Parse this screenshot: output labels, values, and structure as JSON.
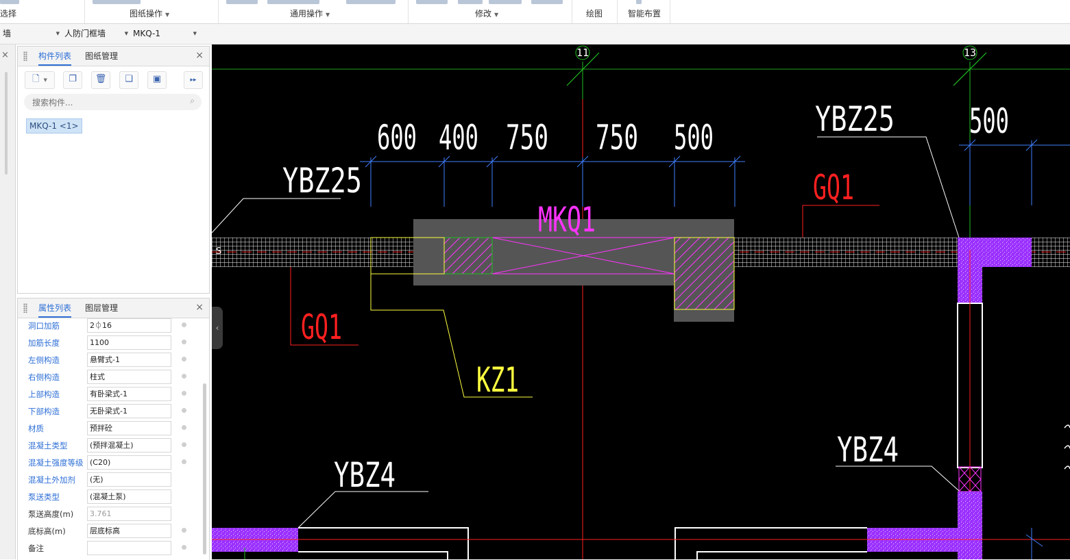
{
  "ribbon": {
    "groups": [
      {
        "label": "选择"
      },
      {
        "label": "图纸操作"
      },
      {
        "label": "通用操作"
      },
      {
        "label": "修改"
      },
      {
        "label": "绘图"
      },
      {
        "label": "智能布置"
      }
    ]
  },
  "toolbar": {
    "combo1": "墙",
    "combo2": "人防门框墙",
    "combo3": "MKQ-1"
  },
  "component_panel": {
    "tabs": [
      "构件列表",
      "图纸管理"
    ],
    "search_placeholder": "搜索构件...",
    "item": "MKQ-1 <1>"
  },
  "property_panel": {
    "tabs": [
      "属性列表",
      "图层管理"
    ],
    "rows": [
      {
        "name": "洞口加筋",
        "value": "2⏀16"
      },
      {
        "name": "加筋长度",
        "value": "1100"
      },
      {
        "name": "左侧构造",
        "value": "悬臂式-1"
      },
      {
        "name": "右侧构造",
        "value": "柱式"
      },
      {
        "name": "上部构造",
        "value": "有卧梁式-1"
      },
      {
        "name": "下部构造",
        "value": "无卧梁式-1"
      },
      {
        "name": "材质",
        "value": "预拌砼"
      },
      {
        "name": "混凝土类型",
        "value": "(预拌混凝土)"
      },
      {
        "name": "混凝土强度等级",
        "value": "(C20)"
      },
      {
        "name": "混凝土外加剂",
        "value": "(无)"
      },
      {
        "name": "泵送类型",
        "value": "(混凝土泵)"
      },
      {
        "name": "泵送高度(m)",
        "value": "3.761"
      },
      {
        "name": "底标高(m)",
        "value": "层底标高"
      },
      {
        "name": "备注",
        "value": ""
      }
    ]
  },
  "drawing": {
    "axis_11": "11",
    "axis_13": "13",
    "dims": [
      "600",
      "400",
      "750",
      "750",
      "500"
    ],
    "dim_right": "500",
    "ybz25_left": "YBZ25",
    "ybz25_right": "YBZ25",
    "gq1_right": "GQ1",
    "gq1_left": "GQ1",
    "mkq1": "MKQ1",
    "kz1": "KZ1",
    "ybz4_left": "YBZ4",
    "ybz4_right": "YBZ4",
    "s_mark": "S"
  },
  "colors": {
    "accent": "#2e6fd6",
    "cad_bg": "#000000",
    "magenta": "#ff33ff",
    "purple_fill": "#9b30ff",
    "red": "#ff2020",
    "yellow": "#ffff40",
    "green": "#20c020"
  }
}
